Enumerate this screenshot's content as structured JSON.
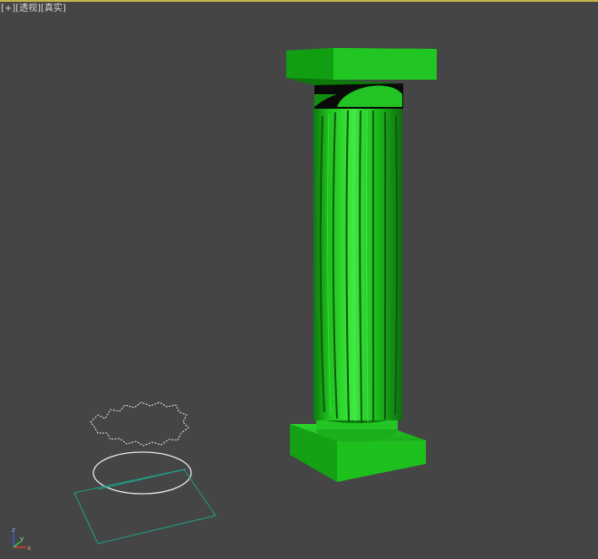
{
  "viewport": {
    "menu": {
      "plus": "[+]",
      "view": "透视",
      "shading": "真实"
    },
    "colors": {
      "background": "#454545",
      "column_green": "#22cc22",
      "spline_white": "#e6e6e6",
      "plane_teal": "#1f9e86",
      "axis_x": "#d23a2a",
      "axis_y": "#3ac23a",
      "axis_z": "#3a5ad2"
    },
    "axis_gizmo": {
      "x": "x",
      "y": "y",
      "z": "z"
    }
  }
}
